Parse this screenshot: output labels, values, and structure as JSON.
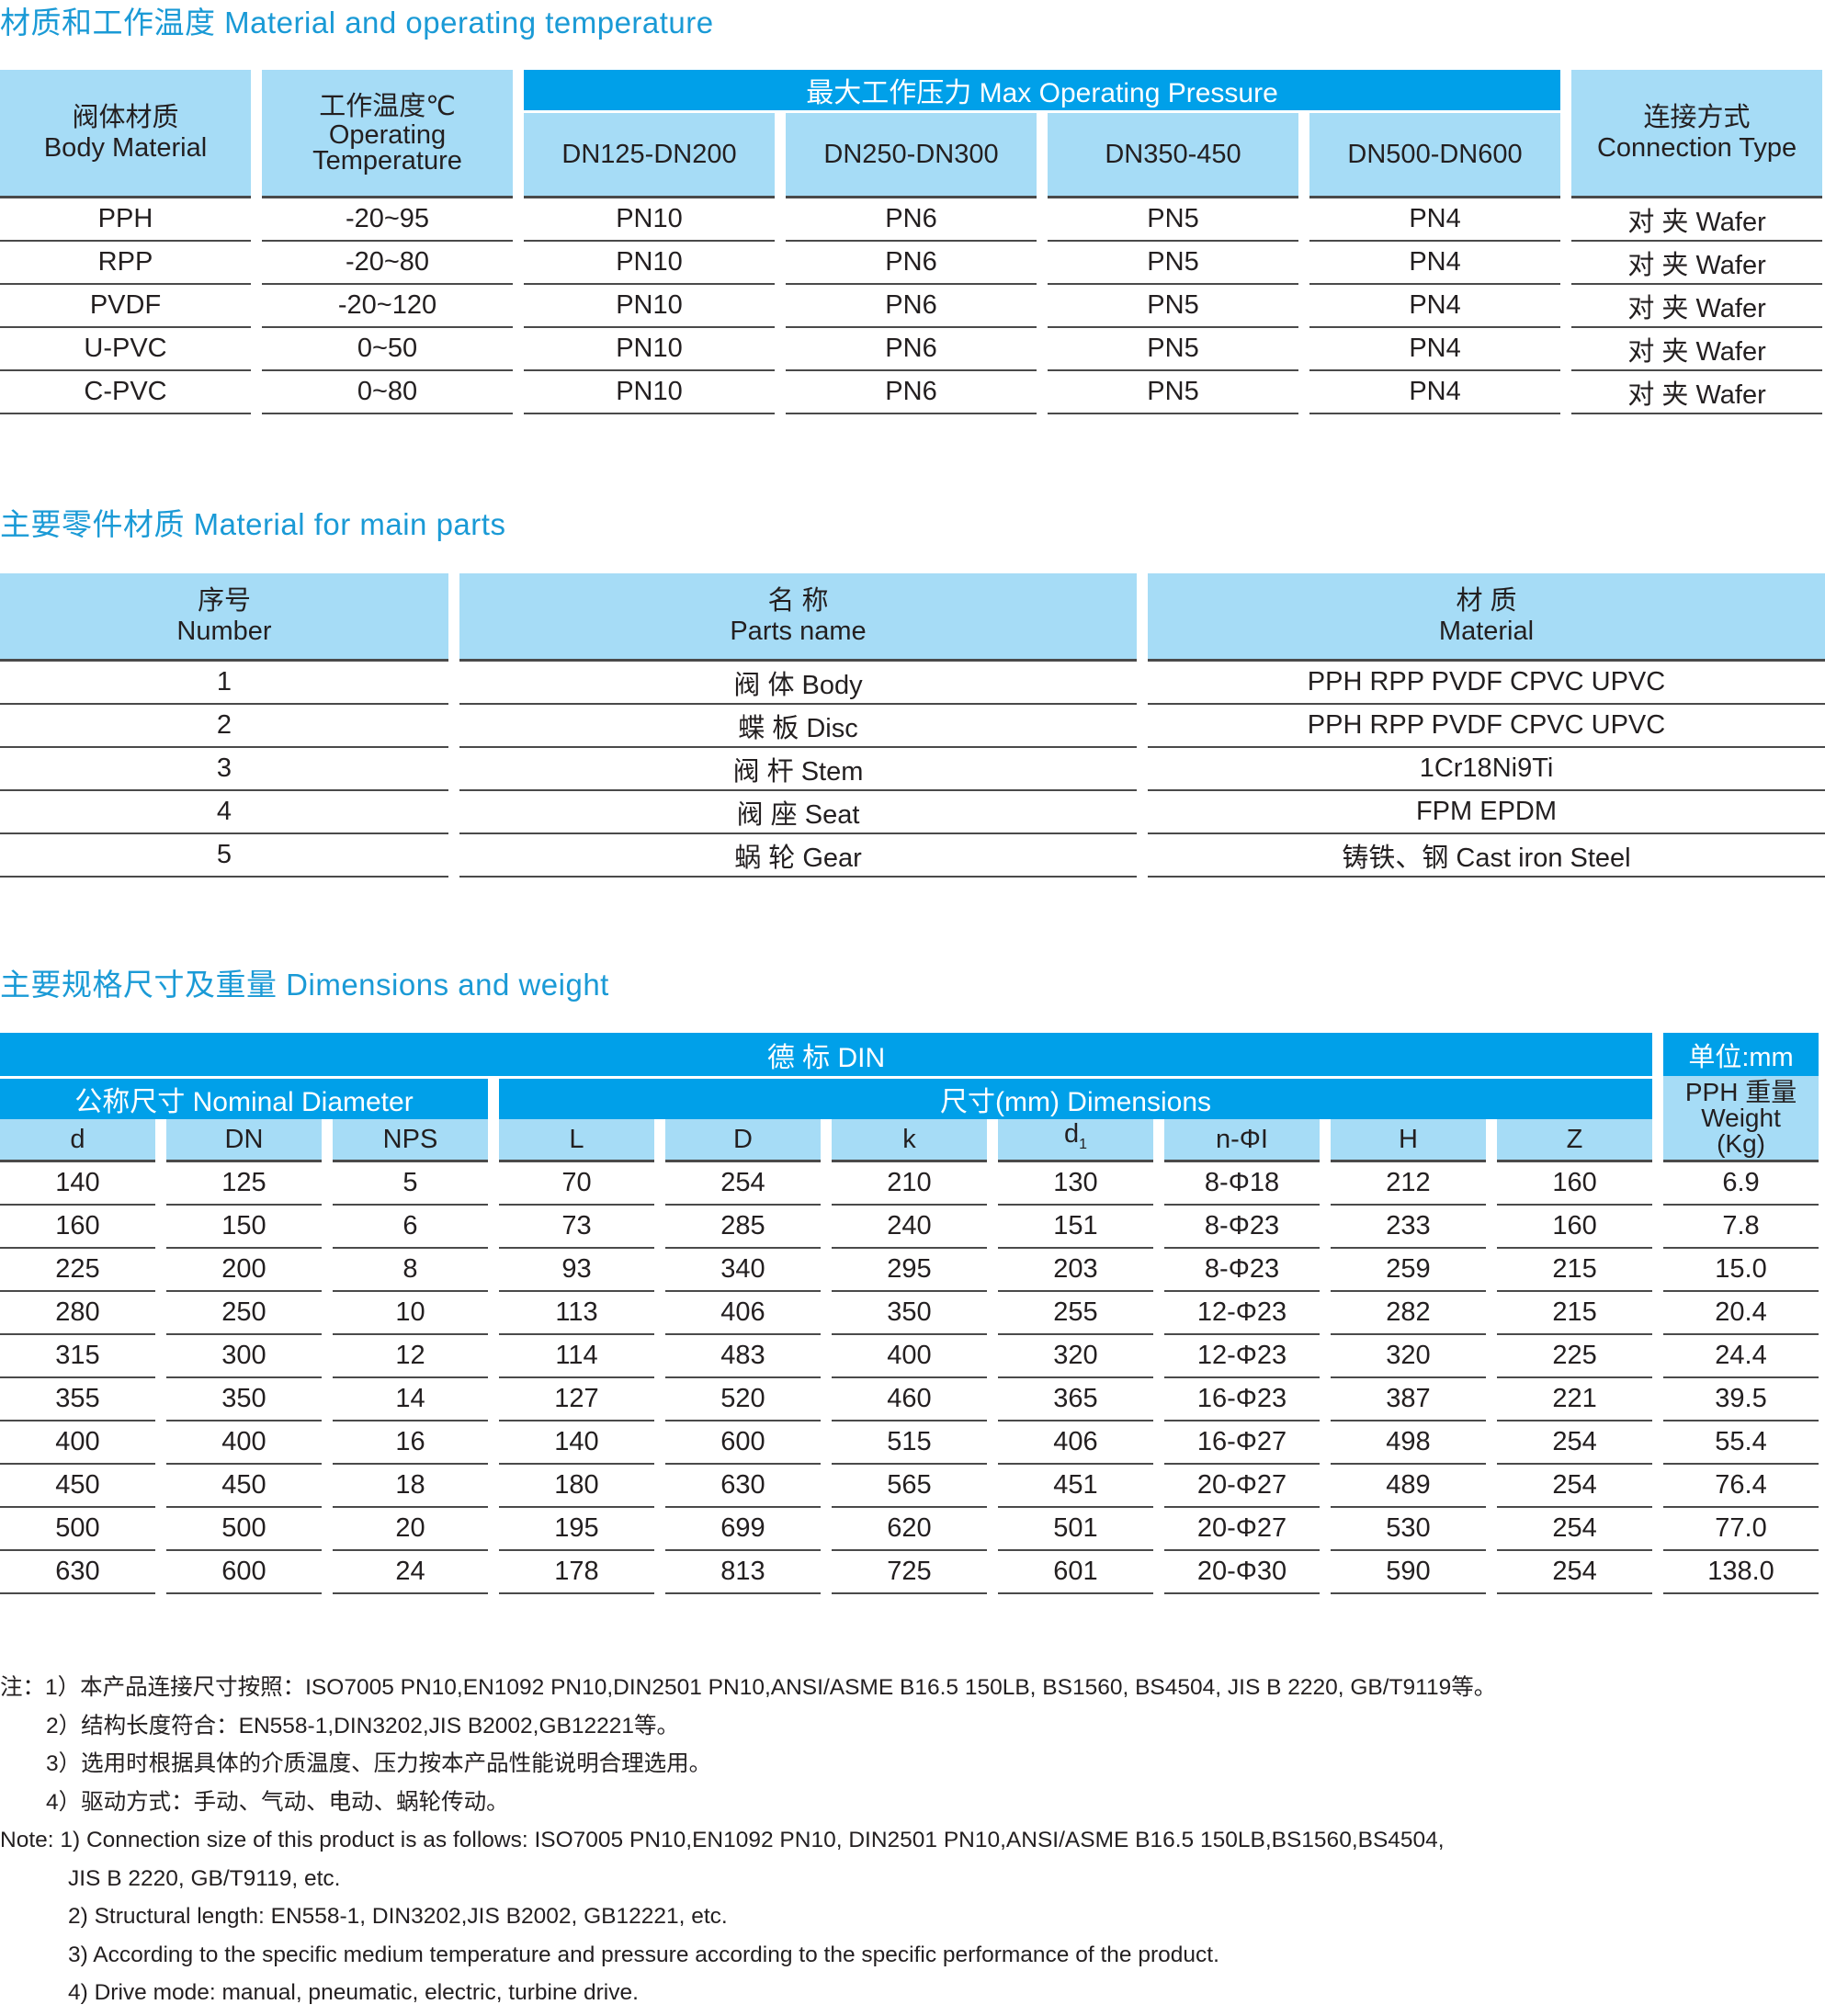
{
  "section1": {
    "title": "材质和工作温度  Material and operating temperature",
    "headers": {
      "body_material_cn": "阀体材质",
      "body_material_en": "Body Material",
      "temp_cn": "工作温度℃",
      "temp_en1": "Operating",
      "temp_en2": "Temperature",
      "pressure": "最大工作压力  Max Operating Pressure",
      "dn1": "DN125-DN200",
      "dn2": "DN250-DN300",
      "dn3": "DN350-450",
      "dn4": "DN500-DN600",
      "conn_cn": "连接方式",
      "conn_en": "Connection Type"
    },
    "rows": [
      [
        "PPH",
        "-20~95",
        "PN10",
        "PN6",
        "PN5",
        "PN4",
        "对 夹  Wafer"
      ],
      [
        "RPP",
        "-20~80",
        "PN10",
        "PN6",
        "PN5",
        "PN4",
        "对 夹  Wafer"
      ],
      [
        "PVDF",
        "-20~120",
        "PN10",
        "PN6",
        "PN5",
        "PN4",
        "对 夹  Wafer"
      ],
      [
        "U-PVC",
        "0~50",
        "PN10",
        "PN6",
        "PN5",
        "PN4",
        "对 夹  Wafer"
      ],
      [
        "C-PVC",
        "0~80",
        "PN10",
        "PN6",
        "PN5",
        "PN4",
        "对 夹  Wafer"
      ]
    ]
  },
  "section2": {
    "title": "主要零件材质  Material for main parts",
    "headers": {
      "num_cn": "序号",
      "num_en": "Number",
      "name_cn": "名 称",
      "name_en": "Parts name",
      "mat_cn": "材 质",
      "mat_en": "Material"
    },
    "rows": [
      [
        "1",
        "阀 体  Body",
        "PPH  RPP  PVDF  CPVC  UPVC"
      ],
      [
        "2",
        "蝶 板  Disc",
        "PPH  RPP  PVDF  CPVC   UPVC"
      ],
      [
        "3",
        "阀 杆  Stem",
        "1Cr18Ni9Ti"
      ],
      [
        "4",
        "阀 座  Seat",
        "FPM  EPDM"
      ],
      [
        "5",
        "蜗 轮  Gear",
        "铸铁、钢 Cast iron  Steel"
      ]
    ]
  },
  "section3": {
    "title": "主要规格尺寸及重量  Dimensions and weight",
    "headers": {
      "din": "德 标  DIN",
      "unit": "单位:mm",
      "nominal": "公称尺寸  Nominal Diameter",
      "dimensions": "尺寸(mm)   Dimensions",
      "weight1": "PPH 重量",
      "weight2": "Weight",
      "weight3": "(Kg)",
      "cols": [
        "d",
        "DN",
        "NPS",
        "L",
        "D",
        "k",
        "d",
        "n-ΦI",
        "H",
        "Z"
      ],
      "d1_sub": "1"
    },
    "rows": [
      [
        "140",
        "125",
        "5",
        "70",
        "254",
        "210",
        "130",
        "8-Φ18",
        "212",
        "160",
        "6.9"
      ],
      [
        "160",
        "150",
        "6",
        "73",
        "285",
        "240",
        "151",
        "8-Φ23",
        "233",
        "160",
        "7.8"
      ],
      [
        "225",
        "200",
        "8",
        "93",
        "340",
        "295",
        "203",
        "8-Φ23",
        "259",
        "215",
        "15.0"
      ],
      [
        "280",
        "250",
        "10",
        "113",
        "406",
        "350",
        "255",
        "12-Φ23",
        "282",
        "215",
        "20.4"
      ],
      [
        "315",
        "300",
        "12",
        "114",
        "483",
        "400",
        "320",
        "12-Φ23",
        "320",
        "225",
        "24.4"
      ],
      [
        "355",
        "350",
        "14",
        "127",
        "520",
        "460",
        "365",
        "16-Φ23",
        "387",
        "221",
        "39.5"
      ],
      [
        "400",
        "400",
        "16",
        "140",
        "600",
        "515",
        "406",
        "16-Φ27",
        "498",
        "254",
        "55.4"
      ],
      [
        "450",
        "450",
        "18",
        "180",
        "630",
        "565",
        "451",
        "20-Φ27",
        "489",
        "254",
        "76.4"
      ],
      [
        "500",
        "500",
        "20",
        "195",
        "699",
        "620",
        "501",
        "20-Φ27",
        "530",
        "254",
        "77.0"
      ],
      [
        "630",
        "600",
        "24",
        "178",
        "813",
        "725",
        "601",
        "20-Φ30",
        "590",
        "254",
        "138.0"
      ]
    ]
  },
  "notes": [
    "注：1）本产品连接尺寸按照：ISO7005 PN10,EN1092 PN10,DIN2501 PN10,ANSI/ASME B16.5 150LB, BS1560, BS4504,  JIS B 2220, GB/T9119等。",
    "2）结构长度符合：EN558-1,DIN3202,JIS B2002,GB12221等。",
    "3）选用时根据具体的介质温度、压力按本产品性能说明合理选用。",
    "4）驱动方式：手动、气动、电动、蜗轮传动。",
    "Note: 1) Connection size of this product is as follows: ISO7005 PN10,EN1092 PN10, DIN2501 PN10,ANSI/ASME B16.5 150LB,BS1560,BS4504,",
    "JIS B 2220, GB/T9119,  etc.",
    "2) Structural length: EN558-1, DIN3202,JIS B2002, GB12221, etc.",
    "3) According to the specific medium temperature and pressure according to the specific performance of the product.",
    "4) Drive mode: manual, pneumatic, electric, turbine drive."
  ]
}
